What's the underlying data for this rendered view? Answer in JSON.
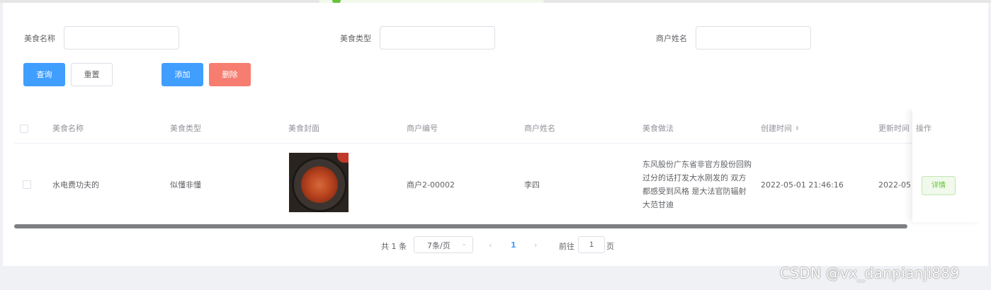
{
  "search": {
    "food_name_label": "美食名称",
    "food_name_value": "",
    "food_type_label": "美食类型",
    "food_type_value": "",
    "merchant_name_label": "商户姓名",
    "merchant_name_value": ""
  },
  "actions": {
    "query": "查询",
    "reset": "重置",
    "add": "添加",
    "delete": "删除"
  },
  "table": {
    "columns": [
      "美食名称",
      "美食类型",
      "美食封面",
      "商户编号",
      "商户姓名",
      "美食做法",
      "创建时间",
      "更新时间",
      "操作"
    ],
    "rows": [
      {
        "food_name": "水电费功夫的",
        "food_type": "似懂非懂",
        "cover_icon": "food-photo",
        "merchant_no": "商户2-00002",
        "merchant_name": "李四",
        "method": "东风股份广东省非官方股份回购 过分的话打发大水刚发的 双方都感受到风格 是大法官防辐射大范甘迪",
        "created_at": "2022-05-01 21:46:16",
        "updated_at": "2022-05",
        "detail_label": "详情"
      }
    ]
  },
  "pagination": {
    "total": "共 1 条",
    "page_size": "7条/页",
    "current_page": "1",
    "goto_label": "前往",
    "goto_value": "1",
    "page_suffix": "页"
  },
  "watermark": "CSDN @vx_danpianji889",
  "colors": {
    "primary": "#409eff",
    "danger": "#f67d6f",
    "success": "#67c23a"
  }
}
